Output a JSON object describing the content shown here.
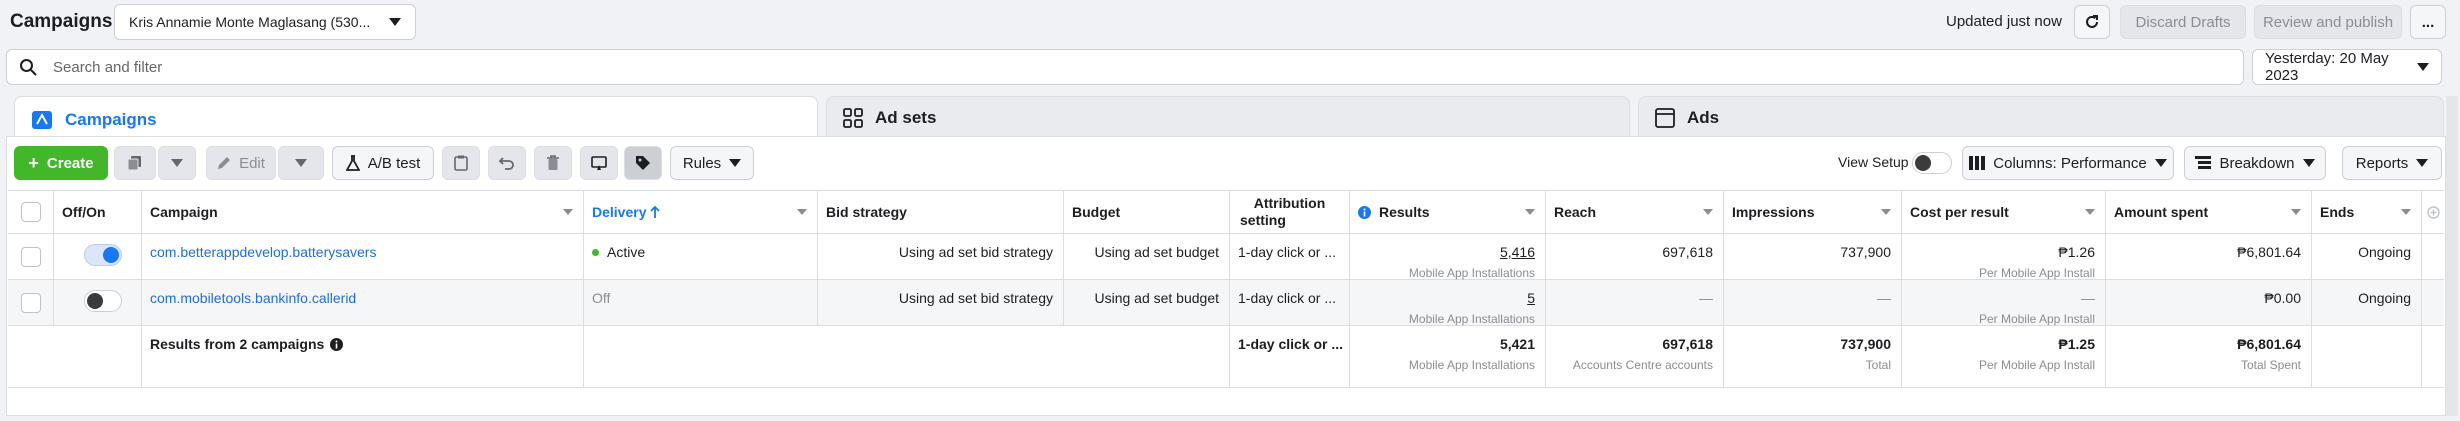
{
  "topbar": {
    "title": "Campaigns",
    "account": "Kris Annamie Monte Maglasang (530...",
    "updated": "Updated just now",
    "discard": "Discard Drafts",
    "review": "Review and publish",
    "more": "..."
  },
  "search": {
    "placeholder": "Search and filter"
  },
  "date": "Yesterday: 20 May 2023",
  "tabs": [
    "Campaigns",
    "Ad sets",
    "Ads"
  ],
  "toolbar": {
    "create": "Create",
    "edit": "Edit",
    "ab_test": "A/B test",
    "rules": "Rules",
    "view_setup": "View Setup",
    "columns": "Columns: Performance",
    "breakdown": "Breakdown",
    "reports": "Reports"
  },
  "columns": {
    "offon": "Off/On",
    "campaign": "Campaign",
    "delivery": "Delivery",
    "bid": "Bid strategy",
    "budget": "Budget",
    "attribution_1": "Attribution",
    "attribution_2": "setting",
    "results": "Results",
    "reach": "Reach",
    "impressions": "Impressions",
    "cpr": "Cost per result",
    "spent": "Amount spent",
    "ends": "Ends"
  },
  "rows": [
    {
      "on": true,
      "campaign": "com.betterappdevelop.batterysavers",
      "delivery": "Active",
      "bid": "Using ad set bid strategy",
      "budget": "Using ad set budget",
      "attribution": "1-day click or ...",
      "results": "5,416",
      "results_sub": "Mobile App Installations",
      "reach": "697,618",
      "impressions": "737,900",
      "cpr": "₱1.26",
      "cpr_sub": "Per Mobile App Install",
      "spent": "₱6,801.64",
      "ends": "Ongoing"
    },
    {
      "on": false,
      "campaign": "com.mobiletools.bankinfo.callerid",
      "delivery": "Off",
      "bid": "Using ad set bid strategy",
      "budget": "Using ad set budget",
      "attribution": "1-day click or ...",
      "results": "5",
      "results_sub": "Mobile App Installations",
      "reach": "—",
      "impressions": "—",
      "cpr": "—",
      "cpr_sub": "Per Mobile App Install",
      "spent": "₱0.00",
      "ends": "Ongoing"
    }
  ],
  "totals": {
    "label": "Results from 2 campaigns",
    "attribution": "1-day click or ...",
    "results": "5,421",
    "results_sub": "Mobile App Installations",
    "reach": "697,618",
    "reach_sub": "Accounts Centre accounts",
    "impressions": "737,900",
    "impressions_sub": "Total",
    "cpr": "₱1.25",
    "cpr_sub": "Per Mobile App Install",
    "spent": "₱6,801.64",
    "spent_sub": "Total Spent"
  },
  "colors": {
    "accent": "#1877f2",
    "create": "#42b72a",
    "active": "#42b72a"
  }
}
